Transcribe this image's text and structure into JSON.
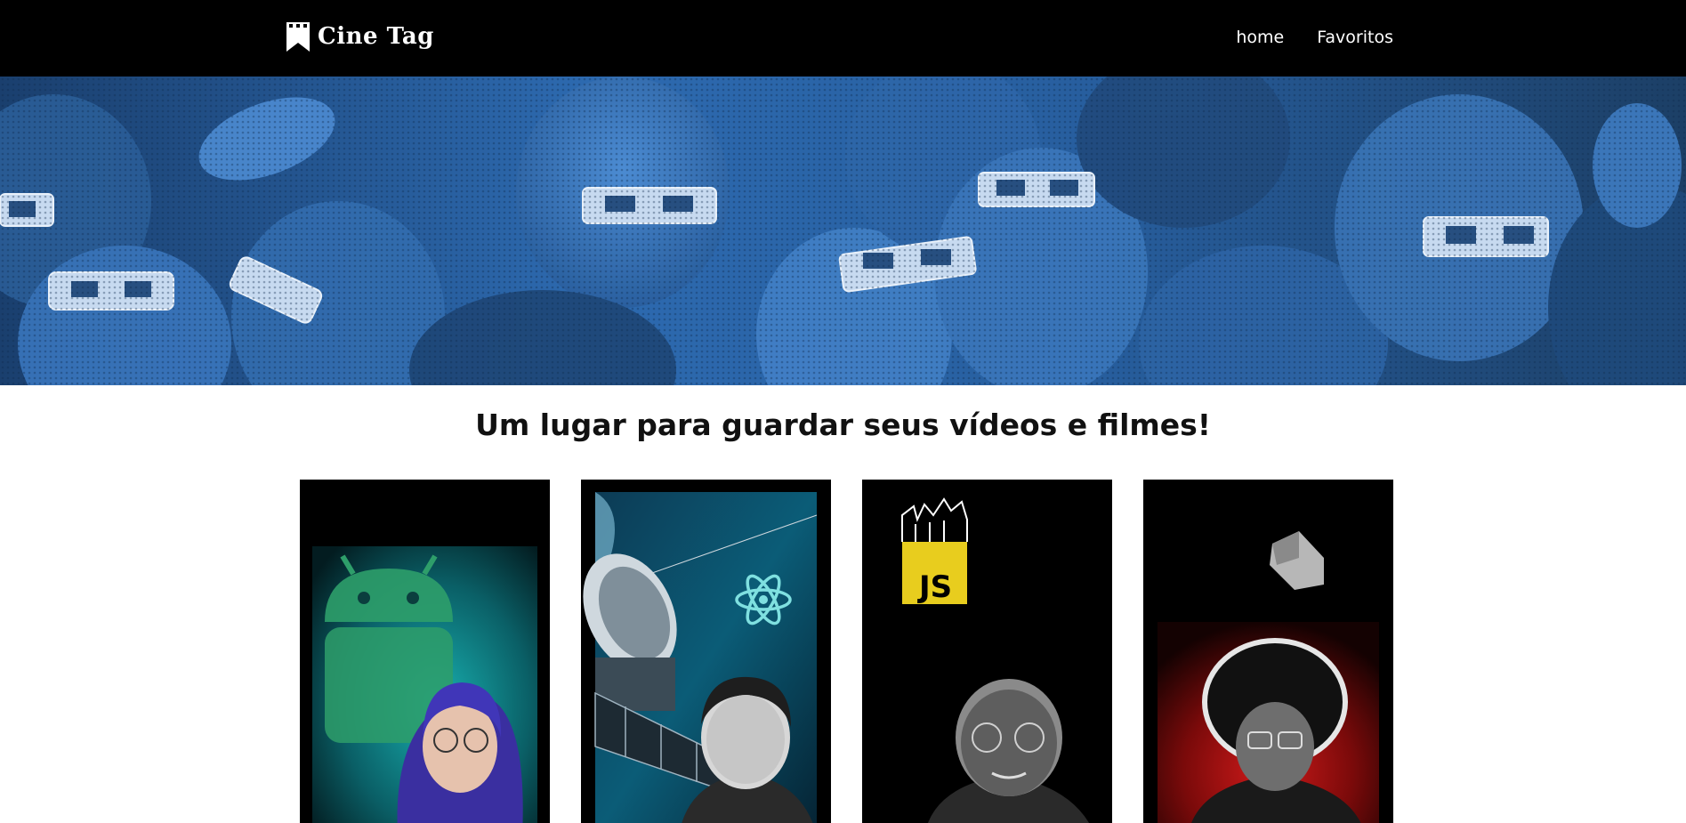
{
  "header": {
    "brand": "Cine Tag",
    "nav": [
      {
        "label": "home"
      },
      {
        "label": "Favoritos"
      }
    ]
  },
  "banner": {
    "icon": "cinema-audience-3d-glasses-image"
  },
  "page": {
    "title": "Um lugar para guardar seus vídeos e filmes!"
  },
  "cards": [
    {
      "theme": "android",
      "thumbnail_text": ""
    },
    {
      "theme": "react",
      "thumbnail_text": ""
    },
    {
      "theme": "javascript",
      "thumbnail_text": "JS"
    },
    {
      "theme": "dart",
      "thumbnail_text": ""
    }
  ],
  "colors": {
    "header_bg": "#000000",
    "banner_tint": "#2d6ab0",
    "js_yellow": "#e8cd1e",
    "android_green": "#2e9e6a",
    "react_cyan": "#7fe0e0",
    "dart_red": "#b01515"
  }
}
